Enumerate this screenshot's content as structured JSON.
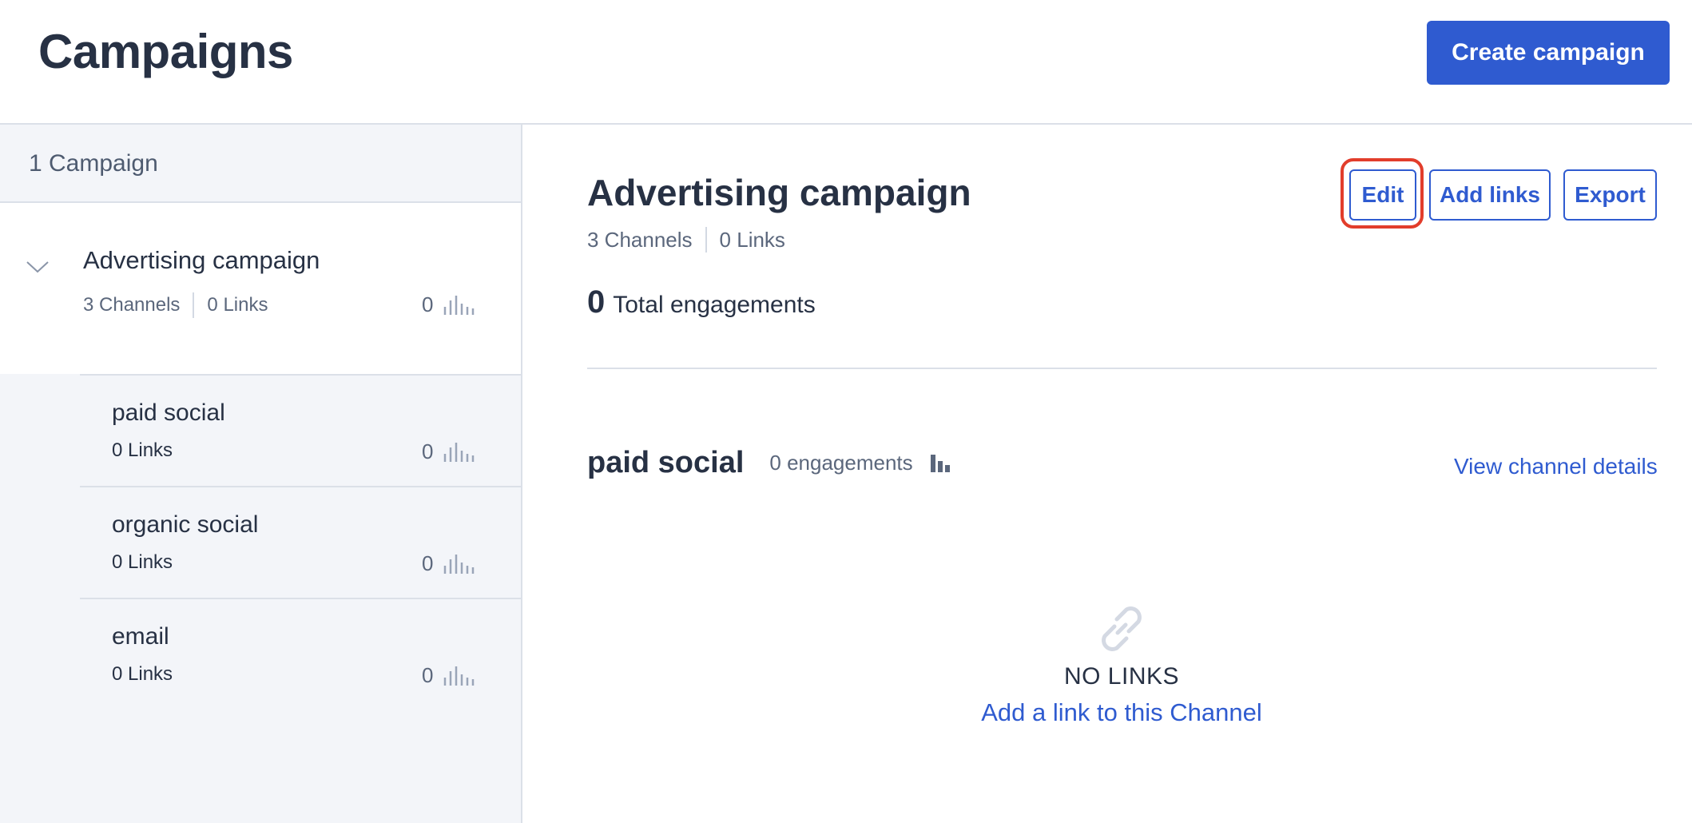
{
  "header": {
    "title": "Campaigns",
    "create_button": "Create campaign"
  },
  "sidebar": {
    "count_label": "1 Campaign",
    "campaign": {
      "name": "Advertising campaign",
      "channels": "3 Channels",
      "links": "0 Links",
      "engagement_count": "0"
    },
    "channels": [
      {
        "name": "paid social",
        "links": "0 Links",
        "engagement_count": "0"
      },
      {
        "name": "organic social",
        "links": "0 Links",
        "engagement_count": "0"
      },
      {
        "name": "email",
        "links": "0 Links",
        "engagement_count": "0"
      }
    ]
  },
  "detail": {
    "title": "Advertising campaign",
    "channels": "3 Channels",
    "links": "0 Links",
    "total_engagements_value": "0",
    "total_engagements_label": "Total engagements",
    "buttons": {
      "edit": "Edit",
      "add_links": "Add links",
      "export": "Export"
    },
    "channel_section": {
      "name": "paid social",
      "engagements": "0 engagements",
      "view_link": "View channel details",
      "empty_title": "NO LINKS",
      "empty_link": "Add a link to this Channel"
    }
  },
  "colors": {
    "accent": "#2f5bd0",
    "highlight": "#e23d2b",
    "sidebar_bg": "#f3f5f9",
    "text": "#273144"
  },
  "icons": {
    "chevron": "chevron-down-icon",
    "sparkline": "sparkline-icon",
    "bar_chart": "bar-chart-icon",
    "link": "link-icon"
  }
}
